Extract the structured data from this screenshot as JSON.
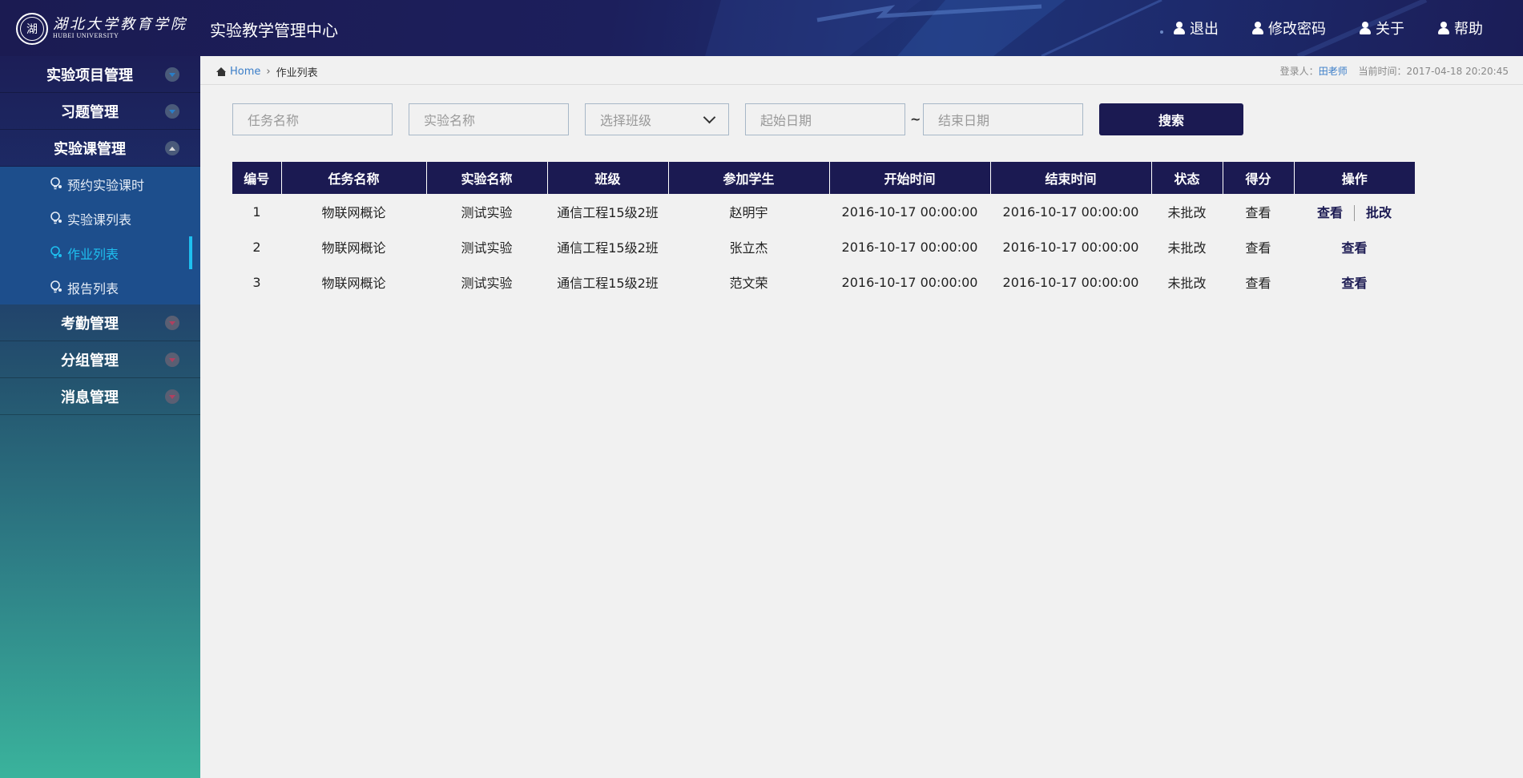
{
  "header": {
    "logo_glyph": "湖",
    "logo_text_cn": "湖北大学教育学院",
    "logo_text_en": "HUBEI UNIVERSITY",
    "title": "实验教学管理中心",
    "nav": [
      {
        "label": "退出",
        "icon": "user-icon"
      },
      {
        "label": "修改密码",
        "icon": "user-icon"
      },
      {
        "label": "关于",
        "icon": "user-icon"
      },
      {
        "label": "帮助",
        "icon": "user-icon"
      }
    ]
  },
  "sidebar": {
    "menus": [
      {
        "label": "实验项目管理",
        "expanded": false
      },
      {
        "label": "习题管理",
        "expanded": false
      },
      {
        "label": "实验课管理",
        "expanded": true
      },
      {
        "label": "考勤管理",
        "expanded": false
      },
      {
        "label": "分组管理",
        "expanded": false
      },
      {
        "label": "消息管理",
        "expanded": false
      }
    ],
    "submenu": [
      {
        "label": "预约实验课时",
        "active": false
      },
      {
        "label": "实验课列表",
        "active": false
      },
      {
        "label": "作业列表",
        "active": true
      },
      {
        "label": "报告列表",
        "active": false
      }
    ]
  },
  "breadcrumb": {
    "home": "Home",
    "current": "作业列表"
  },
  "login": {
    "user_label": "登录人：",
    "user_name": "田老师",
    "time_label": "当前时间：",
    "time_value": "2017-04-18 20:20:45"
  },
  "filters": {
    "task_placeholder": "任务名称",
    "experiment_placeholder": "实验名称",
    "class_select": "选择班级",
    "start_placeholder": "起始日期",
    "range_sep": "~",
    "end_placeholder": "结束日期",
    "search_label": "搜索"
  },
  "table": {
    "columns": [
      "编号",
      "任务名称",
      "实验名称",
      "班级",
      "参加学生",
      "开始时间",
      "结束时间",
      "状态",
      "得分",
      "操作"
    ],
    "rows": [
      {
        "id": "1",
        "task": "物联网概论",
        "experiment": "测试实验",
        "class": "通信工程15级2班",
        "student": "赵明宇",
        "start": "2016-10-17 00:00:00",
        "end": "2016-10-17 00:00:00",
        "status": "未批改",
        "score": "查看",
        "ops": [
          "查看",
          "批改"
        ]
      },
      {
        "id": "2",
        "task": "物联网概论",
        "experiment": "测试实验",
        "class": "通信工程15级2班",
        "student": "张立杰",
        "start": "2016-10-17 00:00:00",
        "end": "2016-10-17 00:00:00",
        "status": "未批改",
        "score": "查看",
        "ops": [
          "查看"
        ]
      },
      {
        "id": "3",
        "task": "物联网概论",
        "experiment": "测试实验",
        "class": "通信工程15级2班",
        "student": "范文荣",
        "start": "2016-10-17 00:00:00",
        "end": "2016-10-17 00:00:00",
        "status": "未批改",
        "score": "查看",
        "ops": [
          "查看"
        ]
      }
    ]
  },
  "colors": {
    "primary": "#1b1a52",
    "accent": "#1ec0f0",
    "link": "#3a7dc8"
  }
}
